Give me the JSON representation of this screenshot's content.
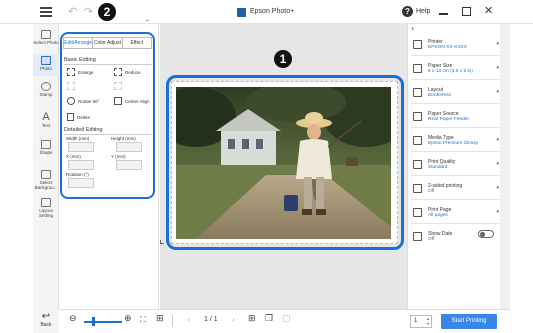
{
  "window": {
    "title": "Epson Photo+",
    "help": "Help"
  },
  "callouts": {
    "canvas": "1",
    "panel": "2"
  },
  "nav": {
    "items": [
      {
        "label": "Select Photo",
        "icon": "select-photo-icon"
      },
      {
        "label": "Photo",
        "icon": "photo-icon"
      },
      {
        "label": "Stamp",
        "icon": "stamp-icon"
      },
      {
        "label": "Text",
        "icon": "text-icon",
        "glyph": "A"
      },
      {
        "label": "Shape",
        "icon": "shape-icon"
      },
      {
        "label": "Select Backgrou...",
        "icon": "background-icon"
      },
      {
        "label": "Layout Setting",
        "icon": "layout-icon"
      }
    ],
    "back": "Back"
  },
  "edit_panel": {
    "tabs": [
      "Edit/Arrange",
      "Color Adjust",
      "Effect"
    ],
    "basic_title": "Basic Editing",
    "tools": {
      "enlarge": "Enlarge",
      "reduce": "Reduce",
      "rotate": "Rotate 90°",
      "center": "Center Align",
      "delete": "Delete"
    },
    "detailed_title": "Detailed Editing",
    "fields": {
      "width": "Width (mm)",
      "height": "Height (mm)",
      "x": "X (mm)",
      "y": "Y (mm)",
      "rotation": "Rotation (°)"
    }
  },
  "settings": [
    {
      "label": "Printer",
      "value": "EPSON XX-XXXX",
      "icon": "printer-icon"
    },
    {
      "label": "Paper Size",
      "value": "9 x 13 cm (3.5 x 5 in)",
      "icon": "paper-size-icon"
    },
    {
      "label": "Layout",
      "value": "Borderless",
      "icon": "layout-icon"
    },
    {
      "label": "Paper Source",
      "value": "Rear Paper Feeder",
      "icon": "paper-source-icon"
    },
    {
      "label": "Media Type",
      "value": "Epson Premium Glossy",
      "icon": "media-type-icon"
    },
    {
      "label": "Print Quality",
      "value": "Standard",
      "icon": "print-quality-icon"
    },
    {
      "label": "2-sided printing",
      "value": "Off",
      "icon": "duplex-icon"
    },
    {
      "label": "Print Page",
      "value": "All pages",
      "icon": "print-page-icon"
    },
    {
      "label": "Show Date",
      "value": "Off",
      "icon": "date-icon"
    }
  ],
  "bottom": {
    "page": "1 / 1",
    "copies": "1",
    "start": "Start Printing"
  },
  "colors": {
    "accent": "#1a6fd6",
    "button": "#3a86e8"
  }
}
